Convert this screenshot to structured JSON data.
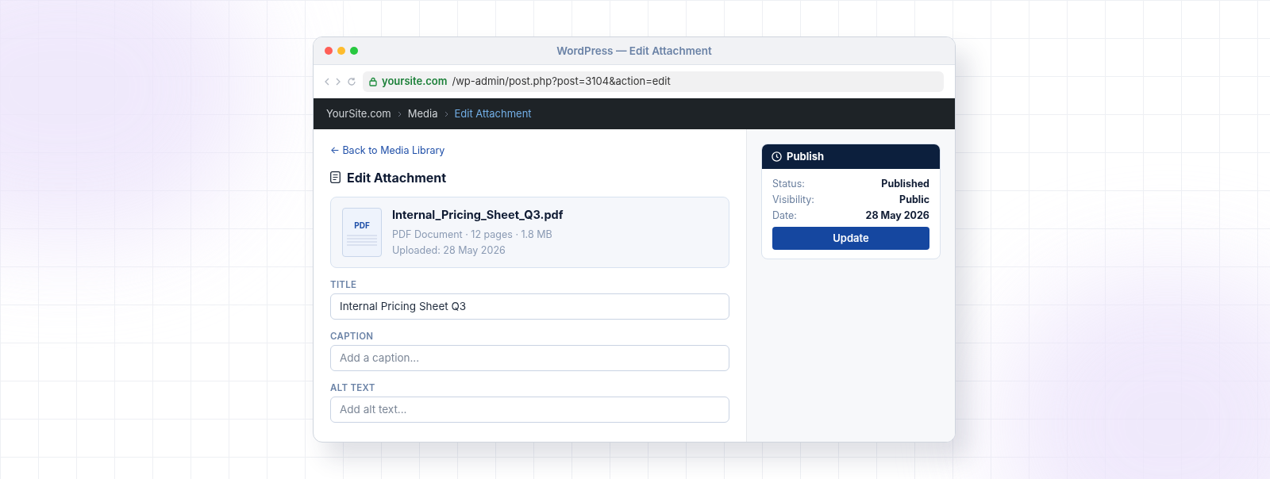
{
  "window": {
    "title": "WordPress — Edit Attachment"
  },
  "address_bar": {
    "domain": "yoursite.com",
    "path": "/wp-admin/post.php?post=3104&action=edit"
  },
  "breadcrumbs": [
    {
      "label": "YourSite.com",
      "selected": false
    },
    {
      "label": "Media",
      "selected": false
    },
    {
      "label": "Edit Attachment",
      "selected": true
    }
  ],
  "back_link": "← Back to Media Library",
  "heading": "Edit Attachment",
  "file": {
    "thumbnail_label": "PDF",
    "name": "Internal_Pricing_Sheet_Q3.pdf",
    "details": "PDF Document · 12 pages · 1.8 MB",
    "uploaded": "Uploaded: 28 May 2026"
  },
  "fields": [
    {
      "label": "TITLE",
      "value": "Internal Pricing Sheet Q3"
    },
    {
      "label": "CAPTION",
      "placeholder": "Add a caption..."
    },
    {
      "label": "ALT TEXT",
      "placeholder": "Add alt text..."
    }
  ],
  "publish": {
    "title": "Publish",
    "rows": [
      {
        "label": "Status:",
        "value": "Published"
      },
      {
        "label": "Visibility:",
        "value": "Public"
      },
      {
        "label": "Date:",
        "value": "28 May 2026"
      }
    ],
    "button": "Update"
  }
}
